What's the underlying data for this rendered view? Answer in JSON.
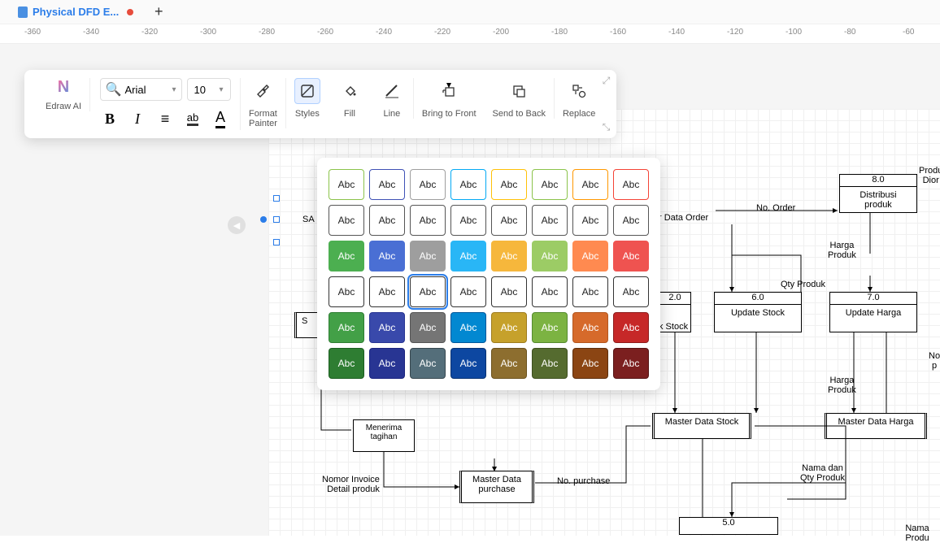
{
  "tab": {
    "title": "Physical DFD E...",
    "modified": true
  },
  "ruler_ticks": [
    "-360",
    "-340",
    "-320",
    "-300",
    "-280",
    "-260",
    "-240",
    "-220",
    "-200",
    "-180",
    "-160",
    "-140",
    "-120",
    "-100",
    "-80",
    "-60"
  ],
  "toolbar": {
    "ai_label": "Edraw AI",
    "font_name": "Arial",
    "font_size": "10",
    "format_painter_label": "Format\nPainter",
    "styles_label": "Styles",
    "fill_label": "Fill",
    "line_label": "Line",
    "bring_to_front_label": "Bring to Front",
    "send_to_back_label": "Send to Back",
    "replace_label": "Replace"
  },
  "swatch_label": "Abc",
  "style_rows": [
    [
      {
        "bg": "#ffffff",
        "fg": "#222",
        "bd": "#8bc34a"
      },
      {
        "bg": "#ffffff",
        "fg": "#222",
        "bd": "#3f51b5"
      },
      {
        "bg": "#ffffff",
        "fg": "#222",
        "bd": "#9e9e9e"
      },
      {
        "bg": "#ffffff",
        "fg": "#222",
        "bd": "#03a9f4"
      },
      {
        "bg": "#ffffff",
        "fg": "#222",
        "bd": "#ffc107"
      },
      {
        "bg": "#ffffff",
        "fg": "#222",
        "bd": "#8bc34a"
      },
      {
        "bg": "#ffffff",
        "fg": "#222",
        "bd": "#ff9800"
      },
      {
        "bg": "#ffffff",
        "fg": "#222",
        "bd": "#f44336"
      }
    ],
    [
      {
        "bg": "#ffffff",
        "fg": "#222",
        "bd": "#555"
      },
      {
        "bg": "#ffffff",
        "fg": "#222",
        "bd": "#555"
      },
      {
        "bg": "#ffffff",
        "fg": "#222",
        "bd": "#555"
      },
      {
        "bg": "#ffffff",
        "fg": "#222",
        "bd": "#555"
      },
      {
        "bg": "#ffffff",
        "fg": "#222",
        "bd": "#555"
      },
      {
        "bg": "#ffffff",
        "fg": "#222",
        "bd": "#555"
      },
      {
        "bg": "#ffffff",
        "fg": "#222",
        "bd": "#555"
      },
      {
        "bg": "#ffffff",
        "fg": "#222",
        "bd": "#555"
      }
    ],
    [
      {
        "bg": "#4caf50",
        "fg": "#fff",
        "bd": "#4caf50"
      },
      {
        "bg": "#4a6fd4",
        "fg": "#fff",
        "bd": "#4a6fd4"
      },
      {
        "bg": "#9e9e9e",
        "fg": "#fff",
        "bd": "#9e9e9e"
      },
      {
        "bg": "#29b6f6",
        "fg": "#fff",
        "bd": "#29b6f6"
      },
      {
        "bg": "#f6b73c",
        "fg": "#fff",
        "bd": "#f6b73c"
      },
      {
        "bg": "#9ccc65",
        "fg": "#fff",
        "bd": "#9ccc65"
      },
      {
        "bg": "#ff8a50",
        "fg": "#fff",
        "bd": "#ff8a50"
      },
      {
        "bg": "#ef5350",
        "fg": "#fff",
        "bd": "#ef5350"
      }
    ],
    [
      {
        "bg": "#ffffff",
        "fg": "#222",
        "bd": "#333",
        "sel": false
      },
      {
        "bg": "#ffffff",
        "fg": "#222",
        "bd": "#333"
      },
      {
        "bg": "#ffffff",
        "fg": "#222",
        "bd": "#333",
        "sel": true
      },
      {
        "bg": "#ffffff",
        "fg": "#222",
        "bd": "#333"
      },
      {
        "bg": "#ffffff",
        "fg": "#222",
        "bd": "#333"
      },
      {
        "bg": "#ffffff",
        "fg": "#222",
        "bd": "#333"
      },
      {
        "bg": "#ffffff",
        "fg": "#222",
        "bd": "#333"
      },
      {
        "bg": "#ffffff",
        "fg": "#222",
        "bd": "#333"
      }
    ],
    [
      {
        "bg": "#43a047",
        "fg": "#fff",
        "bd": "#2e7d32"
      },
      {
        "bg": "#3949ab",
        "fg": "#fff",
        "bd": "#283593"
      },
      {
        "bg": "#757575",
        "fg": "#fff",
        "bd": "#555"
      },
      {
        "bg": "#0288d1",
        "fg": "#fff",
        "bd": "#01579b"
      },
      {
        "bg": "#c6a12b",
        "fg": "#fff",
        "bd": "#9e7c1e"
      },
      {
        "bg": "#7cb342",
        "fg": "#fff",
        "bd": "#558b2f"
      },
      {
        "bg": "#d66a2b",
        "fg": "#fff",
        "bd": "#b3561e"
      },
      {
        "bg": "#c62828",
        "fg": "#fff",
        "bd": "#8e1c1c"
      }
    ],
    [
      {
        "bg": "#2e7d32",
        "fg": "#fff",
        "bd": "#1b5e20"
      },
      {
        "bg": "#283593",
        "fg": "#fff",
        "bd": "#1a237e"
      },
      {
        "bg": "#546e7a",
        "fg": "#fff",
        "bd": "#37474f"
      },
      {
        "bg": "#0d47a1",
        "fg": "#fff",
        "bd": "#083372"
      },
      {
        "bg": "#8d6e2f",
        "fg": "#fff",
        "bd": "#6b521e"
      },
      {
        "bg": "#556b2f",
        "fg": "#fff",
        "bd": "#3e4f1f"
      },
      {
        "bg": "#8b4513",
        "fg": "#fff",
        "bd": "#5d2e0c"
      },
      {
        "bg": "#7b1f1f",
        "fg": "#fff",
        "bd": "#551414"
      }
    ]
  ],
  "diagram": {
    "selected_text": "SA",
    "s_text": "S",
    "data_order_label": "r Data Order",
    "no_order_label": "No. Order",
    "harga_produk_label": "Harga\nProduk",
    "qty_produk_label": "Qty Produk",
    "distribusi": {
      "num": "8.0",
      "label": "Distribusi\nproduk"
    },
    "proses20": {
      "num": "2.0"
    },
    "proses60": {
      "num": "6.0",
      "label": "Update Stock"
    },
    "proses70": {
      "num": "7.0",
      "label": "Update Harga"
    },
    "stock_label": "k Stock",
    "menerima": "Menerima\ntagihan",
    "master_stock": "Master Data Stock",
    "master_harga": "Master Data Harga",
    "master_purchase": "Master Data\npurchase",
    "no_purchase": "No. purchase",
    "nomor_invoice": "Nomor Invoice\nDetail produk",
    "nama_qty": "Nama dan\nQty Produk",
    "proses50": {
      "num": "5.0"
    },
    "harga_produk2": "Harga\nProduk",
    "nama_produ": "Nama Produ",
    "produ_dior": "Produ\nDior",
    "no_p": "No\np"
  }
}
